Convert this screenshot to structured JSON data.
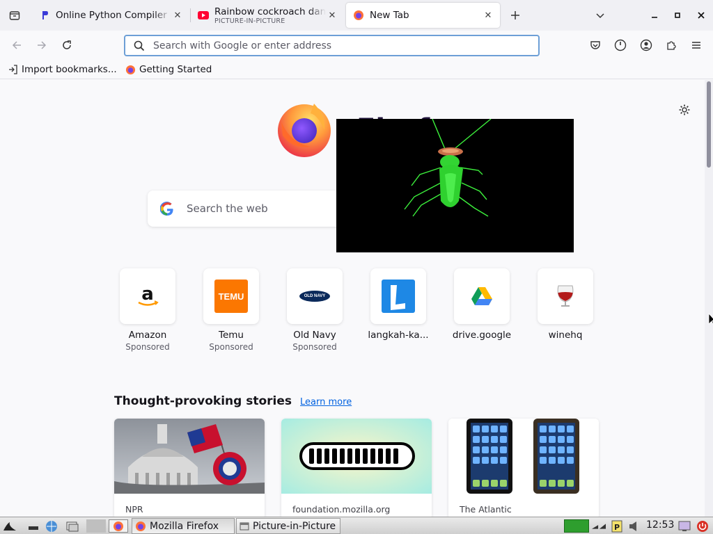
{
  "tabs": [
    {
      "title": "Online Python Compiler (Interpreter)",
      "subtitle": ""
    },
    {
      "title": "Rainbow cockroach dancing",
      "subtitle": "PICTURE-IN-PICTURE"
    },
    {
      "title": "New Tab",
      "subtitle": ""
    }
  ],
  "urlbar": {
    "placeholder": "Search with Google or enter address"
  },
  "bookmarks": [
    {
      "label": "Import bookmarks..."
    },
    {
      "label": "Getting Started"
    }
  ],
  "newtab": {
    "search_placeholder": "Search the web",
    "wordmark": "Firefox",
    "shortcuts": [
      {
        "name": "Amazon",
        "sponsored": "Sponsored",
        "icon": "amazon-logo"
      },
      {
        "name": "Temu",
        "sponsored": "Sponsored",
        "icon": "temu-logo"
      },
      {
        "name": "Old Navy",
        "sponsored": "Sponsored",
        "icon": "old-navy-logo"
      },
      {
        "name": "langkah-ka...",
        "sponsored": "",
        "icon": "langkah-logo"
      },
      {
        "name": "drive.google",
        "sponsored": "",
        "icon": "google-drive-logo"
      },
      {
        "name": "winehq",
        "sponsored": "",
        "icon": "wine-glass-logo"
      }
    ],
    "stories_title": "Thought-provoking stories",
    "learn_more": "Learn more",
    "temu_logo_text": "TEMU",
    "oldnavy_logo_text": "OLD NAVY",
    "stories": [
      {
        "source": "NPR"
      },
      {
        "source": "foundation.mozilla.org"
      },
      {
        "source": "The Atlantic"
      }
    ]
  },
  "taskbar": {
    "tasks": [
      {
        "label": "Mozilla Firefox"
      },
      {
        "label": "Picture-in-Picture"
      }
    ],
    "clock": "12:53"
  },
  "colors": {
    "accent": "#0061e0",
    "focus_ring": "#6d9fd6",
    "tab_strip": "#f0f0f4",
    "page_bg": "#f9f9fb",
    "pip_bg": "#000000",
    "cockroach": "#3cf03c"
  }
}
